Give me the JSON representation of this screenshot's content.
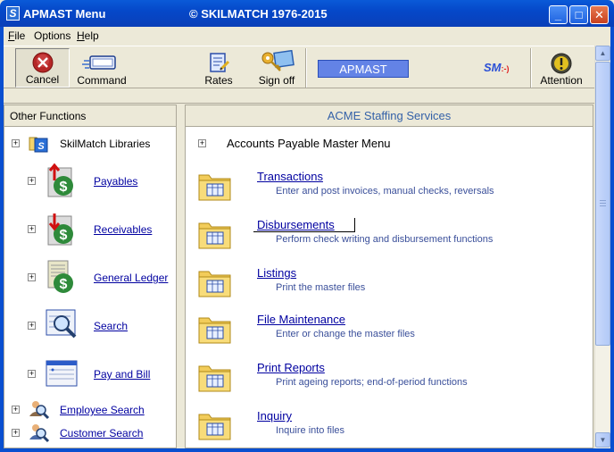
{
  "window": {
    "title": "APMAST Menu",
    "copyright": "© SKILMATCH 1976-2015",
    "app_icon": "S",
    "buttons": [
      "minimize-icon",
      "maximize-icon",
      "close-icon"
    ]
  },
  "menubar": {
    "items": [
      {
        "label": "File",
        "key": "F",
        "rest": "ile"
      },
      {
        "label": "Options",
        "key": "",
        "rest": "Options"
      },
      {
        "label": "Help",
        "key": "H",
        "rest": "elp"
      }
    ]
  },
  "toolbar": {
    "cancel": "Cancel",
    "command": "Command",
    "rates": "Rates",
    "signoff": "Sign off",
    "module": "APMAST",
    "sm_logo": "SM",
    "sm_suffix": ":-)",
    "attention": "Attention"
  },
  "left": {
    "header": "Other Functions",
    "items": [
      {
        "label": "SkilMatch Libraries",
        "icon": "skilmatch-library-icon"
      },
      {
        "label": "Payables",
        "icon": "payables-icon"
      },
      {
        "label": "Receivables",
        "icon": "receivables-icon"
      },
      {
        "label": "General Ledger",
        "icon": "general-ledger-icon"
      },
      {
        "label": "Search",
        "icon": "search-icon"
      },
      {
        "label": "Pay and Bill",
        "icon": "pay-and-bill-icon"
      },
      {
        "label": "Employee Search",
        "icon": "employee-search-icon"
      },
      {
        "label": "Customer Search",
        "icon": "customer-search-icon"
      }
    ]
  },
  "right": {
    "header": "ACME Staffing Services",
    "menu_title": "Accounts Payable Master Menu",
    "items": [
      {
        "label": "Transactions",
        "desc": "Enter and post invoices, manual checks, reversals"
      },
      {
        "label": "Disbursements",
        "desc": "Perform check writing and disbursement functions"
      },
      {
        "label": "Listings",
        "desc": "Print the master files"
      },
      {
        "label": "File Maintenance",
        "desc": "Enter or change the master files"
      },
      {
        "label": "Print Reports",
        "desc": "Print ageing reports; end-of-period functions"
      },
      {
        "label": "Inquiry",
        "desc": "Inquire into files"
      }
    ]
  },
  "colors": {
    "titlebar": "#0548c9",
    "link": "#0000a0",
    "desc": "#3a4f9a",
    "header_text": "#3461a8",
    "module_box": "#6383e6"
  }
}
